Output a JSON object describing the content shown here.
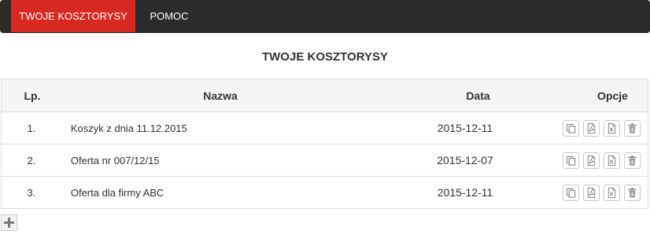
{
  "nav": {
    "items": [
      {
        "label": "TWOJE KOSZTORYSY",
        "active": true
      },
      {
        "label": "POMOC",
        "active": false
      }
    ],
    "bg_color": "#2b2b2b",
    "active_color": "#d72822"
  },
  "page": {
    "title": "TWOJE KOSZTORYSY"
  },
  "table": {
    "headers": {
      "lp": "Lp.",
      "name": "Nazwa",
      "date": "Data",
      "options": "Opcje"
    },
    "rows": [
      {
        "lp": "1.",
        "name": "Koszyk z dnia 11.12.2015",
        "date": "2015-12-11"
      },
      {
        "lp": "2.",
        "name": "Oferta nr 007/12/15",
        "date": "2015-12-07"
      },
      {
        "lp": "3.",
        "name": "Oferta dla firmy ABC",
        "date": "2015-12-11"
      }
    ],
    "row_icons": [
      "copy-icon",
      "pdf-icon",
      "excel-icon",
      "trash-icon"
    ]
  },
  "add_button": {
    "icon": "plus-icon"
  }
}
